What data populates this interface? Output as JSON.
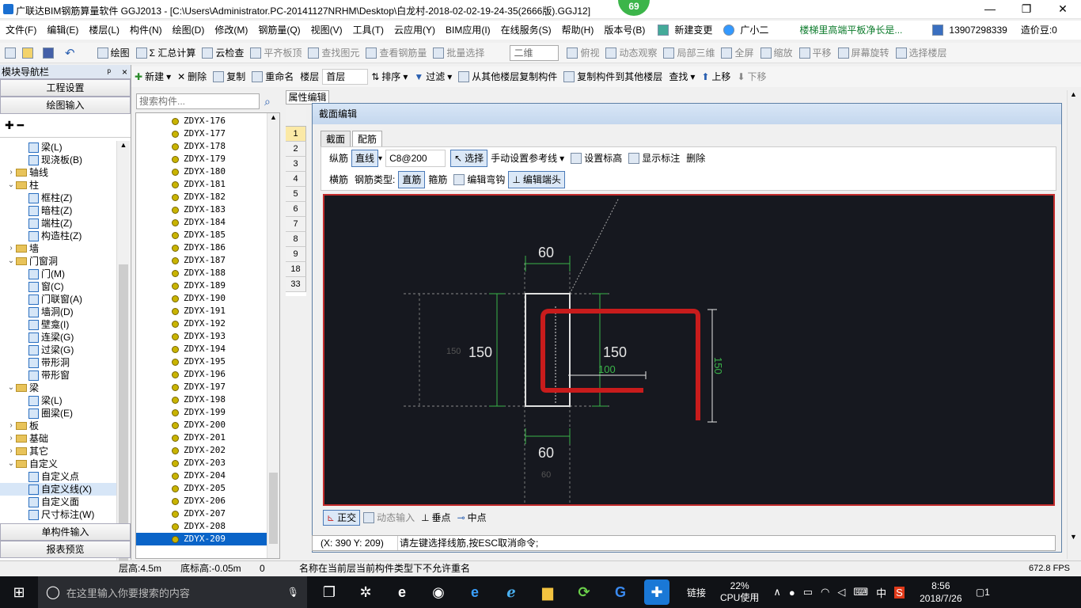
{
  "window": {
    "title": "广联达BIM钢筋算量软件 GGJ2013 - [C:\\Users\\Administrator.PC-20141127NRHM\\Desktop\\白龙村-2018-02-02-19-24-35(2666版).GGJ12]",
    "badge": "69",
    "min": "—",
    "restore": "❐",
    "close": "✕"
  },
  "menu": [
    "文件(F)",
    "编辑(E)",
    "楼层(L)",
    "构件(N)",
    "绘图(D)",
    "修改(M)",
    "钢筋量(Q)",
    "视图(V)",
    "工具(T)",
    "云应用(Y)",
    "BIM应用(I)",
    "在线服务(S)",
    "帮助(H)",
    "版本号(B)"
  ],
  "menu_right": {
    "new_change": "新建变更",
    "assistant": "广小二",
    "notice": "楼梯里高端平板净长是...",
    "phone": "13907298339",
    "price": "造价豆:0"
  },
  "toolbar1": [
    "绘图",
    "Σ 汇总计算",
    "云检查",
    "平齐板顶",
    "查找图元",
    "查看钢筋量",
    "批量选择"
  ],
  "toolbar1_right": {
    "view_mode": "二维",
    "items": [
      "俯视",
      "动态观察",
      "局部三维",
      "全屏",
      "缩放",
      "平移",
      "屏幕旋转",
      "选择楼层"
    ]
  },
  "nav": {
    "title": "模块导航栏",
    "pin": "ᵖ",
    "close": "×",
    "btn_settings": "工程设置",
    "btn_draw": "绘图输入",
    "btn_single": "单构件输入",
    "btn_report": "报表预览"
  },
  "tree": [
    {
      "label": "梁(L)",
      "lvl": 2,
      "icon": "beam"
    },
    {
      "label": "现浇板(B)",
      "lvl": 2,
      "icon": "slab"
    },
    {
      "label": "轴线",
      "lvl": 0,
      "icon": "folder",
      "tog": "›"
    },
    {
      "label": "柱",
      "lvl": 0,
      "icon": "folder",
      "tog": "⌄"
    },
    {
      "label": "框柱(Z)",
      "lvl": 2,
      "icon": "col"
    },
    {
      "label": "暗柱(Z)",
      "lvl": 2,
      "icon": "col"
    },
    {
      "label": "端柱(Z)",
      "lvl": 2,
      "icon": "col"
    },
    {
      "label": "构造柱(Z)",
      "lvl": 2,
      "icon": "col"
    },
    {
      "label": "墙",
      "lvl": 0,
      "icon": "folder",
      "tog": "›"
    },
    {
      "label": "门窗洞",
      "lvl": 0,
      "icon": "folder",
      "tog": "⌄"
    },
    {
      "label": "门(M)",
      "lvl": 2,
      "icon": "door"
    },
    {
      "label": "窗(C)",
      "lvl": 2,
      "icon": "win"
    },
    {
      "label": "门联窗(A)",
      "lvl": 2,
      "icon": "dw"
    },
    {
      "label": "墙洞(D)",
      "lvl": 2,
      "icon": "hole"
    },
    {
      "label": "壁龛(I)",
      "lvl": 2,
      "icon": "niche"
    },
    {
      "label": "连梁(G)",
      "lvl": 2,
      "icon": "lb"
    },
    {
      "label": "过梁(G)",
      "lvl": 2,
      "icon": "gl"
    },
    {
      "label": "带形洞",
      "lvl": 2,
      "icon": "bh"
    },
    {
      "label": "带形窗",
      "lvl": 2,
      "icon": "bw"
    },
    {
      "label": "梁",
      "lvl": 0,
      "icon": "folder",
      "tog": "⌄"
    },
    {
      "label": "梁(L)",
      "lvl": 2,
      "icon": "beam"
    },
    {
      "label": "圈梁(E)",
      "lvl": 2,
      "icon": "beam"
    },
    {
      "label": "板",
      "lvl": 0,
      "icon": "folder",
      "tog": "›"
    },
    {
      "label": "基础",
      "lvl": 0,
      "icon": "folder",
      "tog": "›"
    },
    {
      "label": "其它",
      "lvl": 0,
      "icon": "folder",
      "tog": "›"
    },
    {
      "label": "自定义",
      "lvl": 0,
      "icon": "folder",
      "tog": "⌄"
    },
    {
      "label": "自定义点",
      "lvl": 2,
      "icon": "pt"
    },
    {
      "label": "自定义线(X)",
      "lvl": 2,
      "icon": "ln",
      "sel": true
    },
    {
      "label": "自定义面",
      "lvl": 2,
      "icon": "fc"
    },
    {
      "label": "尺寸标注(W)",
      "lvl": 2,
      "icon": "dim"
    }
  ],
  "search": {
    "placeholder": "搜索构件..."
  },
  "components": [
    "ZDYX-176",
    "ZDYX-177",
    "ZDYX-178",
    "ZDYX-179",
    "ZDYX-180",
    "ZDYX-181",
    "ZDYX-182",
    "ZDYX-183",
    "ZDYX-184",
    "ZDYX-185",
    "ZDYX-186",
    "ZDYX-187",
    "ZDYX-188",
    "ZDYX-189",
    "ZDYX-190",
    "ZDYX-191",
    "ZDYX-192",
    "ZDYX-193",
    "ZDYX-194",
    "ZDYX-195",
    "ZDYX-196",
    "ZDYX-197",
    "ZDYX-198",
    "ZDYX-199",
    "ZDYX-200",
    "ZDYX-201",
    "ZDYX-202",
    "ZDYX-203",
    "ZDYX-204",
    "ZDYX-205",
    "ZDYX-206",
    "ZDYX-207",
    "ZDYX-208",
    "ZDYX-209"
  ],
  "toolbar2": {
    "new": "新建",
    "delete": "删除",
    "copy": "复制",
    "rename": "重命名",
    "floor_label": "楼层",
    "floor": "首层",
    "sort": "排序",
    "filter": "过滤",
    "copy_from": "从其他楼层复制构件",
    "copy_to": "复制构件到其他楼层",
    "find": "查找",
    "up": "上移",
    "down": "下移"
  },
  "prop_tab": "属性编辑",
  "grid_rows": [
    "1",
    "2",
    "3",
    "4",
    "5",
    "6",
    "7",
    "8",
    "9",
    "18",
    "33"
  ],
  "dialog": {
    "title": "截面编辑",
    "tab1": "截面",
    "tab2": "配筋",
    "tb1": {
      "long": "纵筋",
      "line": "直线",
      "spec": "C8@200",
      "select": "选择",
      "manual_ref": "手动设置参考线",
      "set_elev": "设置标高",
      "show_dim": "显示标注",
      "delete": "删除"
    },
    "tb2": {
      "trans": "横筋",
      "type_label": "钢筋类型:",
      "straight": "直筋",
      "stirrup": "箍筋",
      "edit_hook": "编辑弯钩",
      "edit_end": "编辑端头"
    },
    "bottom": {
      "ortho": "正交",
      "dyn": "动态输入",
      "perp": "垂点",
      "mid": "中点"
    },
    "dims": {
      "top": "60",
      "bottom": "60",
      "left": "150",
      "right": "150",
      "rebar_h": "150",
      "rebar_w": "100",
      "ghost_left": "150",
      "ghost_bottom": "60"
    }
  },
  "cmd": {
    "coord": "(X: 390 Y: 209)",
    "msg": "请左键选择线筋,按ESC取消命令;"
  },
  "status": {
    "floor_h": "层高:4.5m",
    "base_h": "底标高:-0.05m",
    "zero": "0",
    "msg": "名称在当前层当前构件类型下不允许重名",
    "fps": "672.8 FPS"
  },
  "taskbar": {
    "search": "在这里输入你要搜索的内容",
    "cpu_pct": "22%",
    "cpu_label": "CPU使用",
    "link": "链接",
    "ime": "中",
    "time": "8:56",
    "date": "2018/7/26",
    "notif": "1"
  }
}
